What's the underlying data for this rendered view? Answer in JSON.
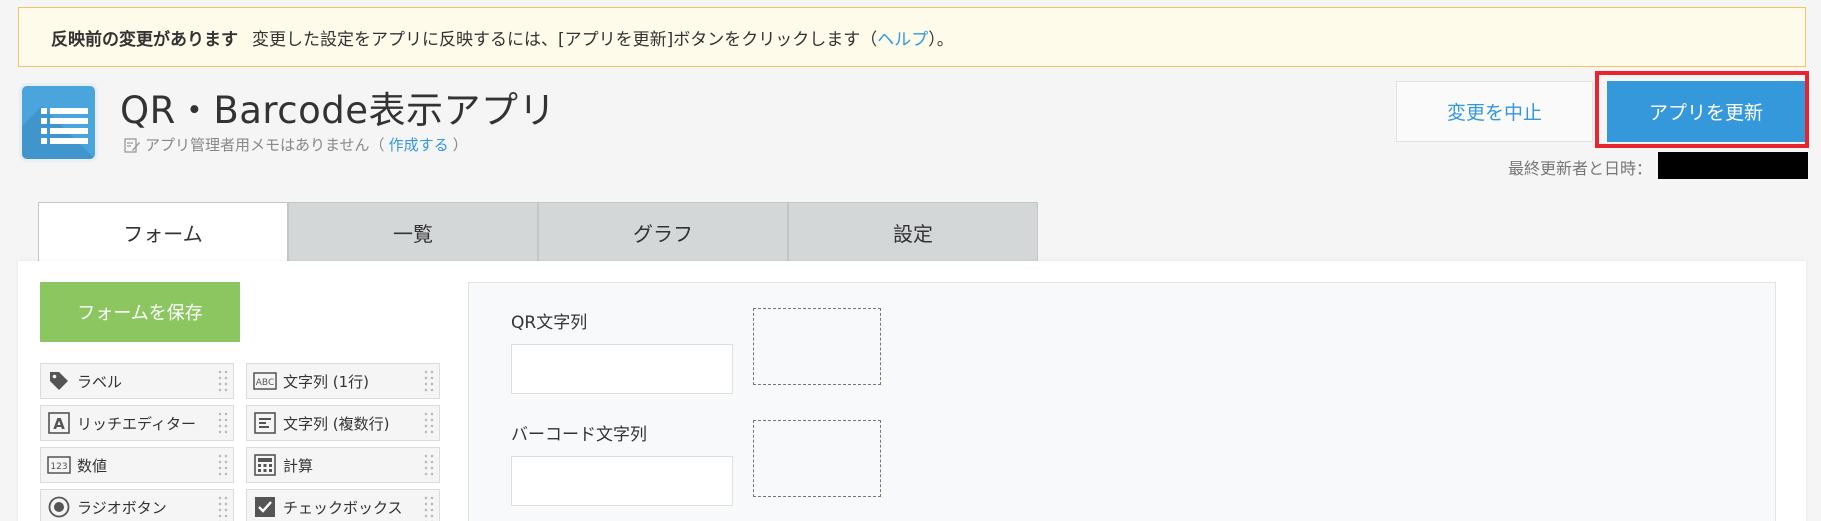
{
  "notice": {
    "title": "反映前の変更があります",
    "message": "変更した設定をアプリに反映するには、[アプリを更新]ボタンをクリックします（",
    "help_link": "ヘルプ",
    "suffix": "）。"
  },
  "app": {
    "title": "QR・Barcode表示アプリ",
    "memo_text": "アプリ管理者用メモはありません（",
    "memo_link": "作成する",
    "memo_suffix": "）"
  },
  "actions": {
    "cancel_label": "変更を中止",
    "update_label": "アプリを更新",
    "last_updated_label": "最終更新者と日時："
  },
  "tabs": [
    {
      "label": "フォーム",
      "active": true
    },
    {
      "label": "一覧",
      "active": false
    },
    {
      "label": "グラフ",
      "active": false
    },
    {
      "label": "設定",
      "active": false
    }
  ],
  "form_editor": {
    "save_label": "フォームを保存",
    "palette": [
      {
        "label": "ラベル",
        "icon": "tag-icon"
      },
      {
        "label": "文字列 (1行)",
        "icon": "abc-icon"
      },
      {
        "label": "リッチエディター",
        "icon": "rich-editor-icon"
      },
      {
        "label": "文字列 (複数行)",
        "icon": "multiline-icon"
      },
      {
        "label": "数値",
        "icon": "number-icon"
      },
      {
        "label": "計算",
        "icon": "calculator-icon"
      },
      {
        "label": "ラジオボタン",
        "icon": "radio-icon"
      },
      {
        "label": "チェックボックス",
        "icon": "checkbox-icon"
      }
    ],
    "fields": [
      {
        "label": "QR文字列"
      },
      {
        "label": "バーコード文字列"
      }
    ]
  },
  "colors": {
    "accent": "#3498db",
    "save": "#8cc660",
    "highlight": "#e8252f",
    "notice_bg": "#fffbea"
  }
}
